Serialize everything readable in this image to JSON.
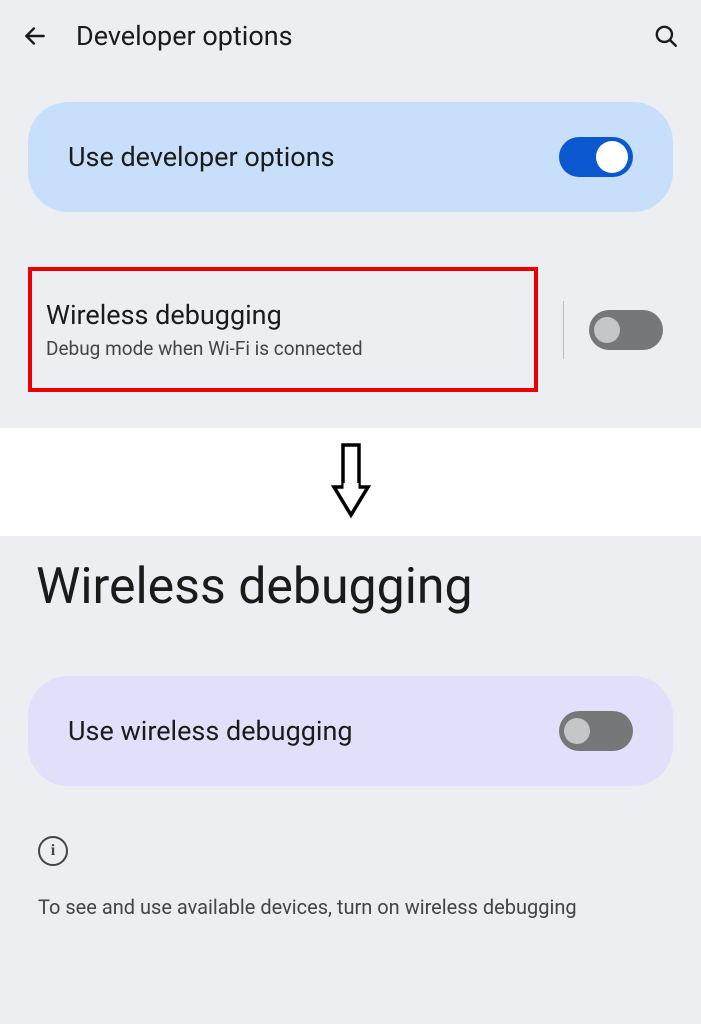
{
  "header": {
    "title": "Developer options"
  },
  "devOptions": {
    "useDevOptions": {
      "label": "Use developer options",
      "state": "on"
    },
    "wirelessDebugging": {
      "title": "Wireless debugging",
      "description": "Debug mode when Wi-Fi is connected",
      "state": "off"
    }
  },
  "wirelessPage": {
    "title": "Wireless debugging",
    "useWireless": {
      "label": "Use wireless debugging",
      "state": "off"
    },
    "infoText": "To see and use available devices, turn on wireless debugging"
  }
}
